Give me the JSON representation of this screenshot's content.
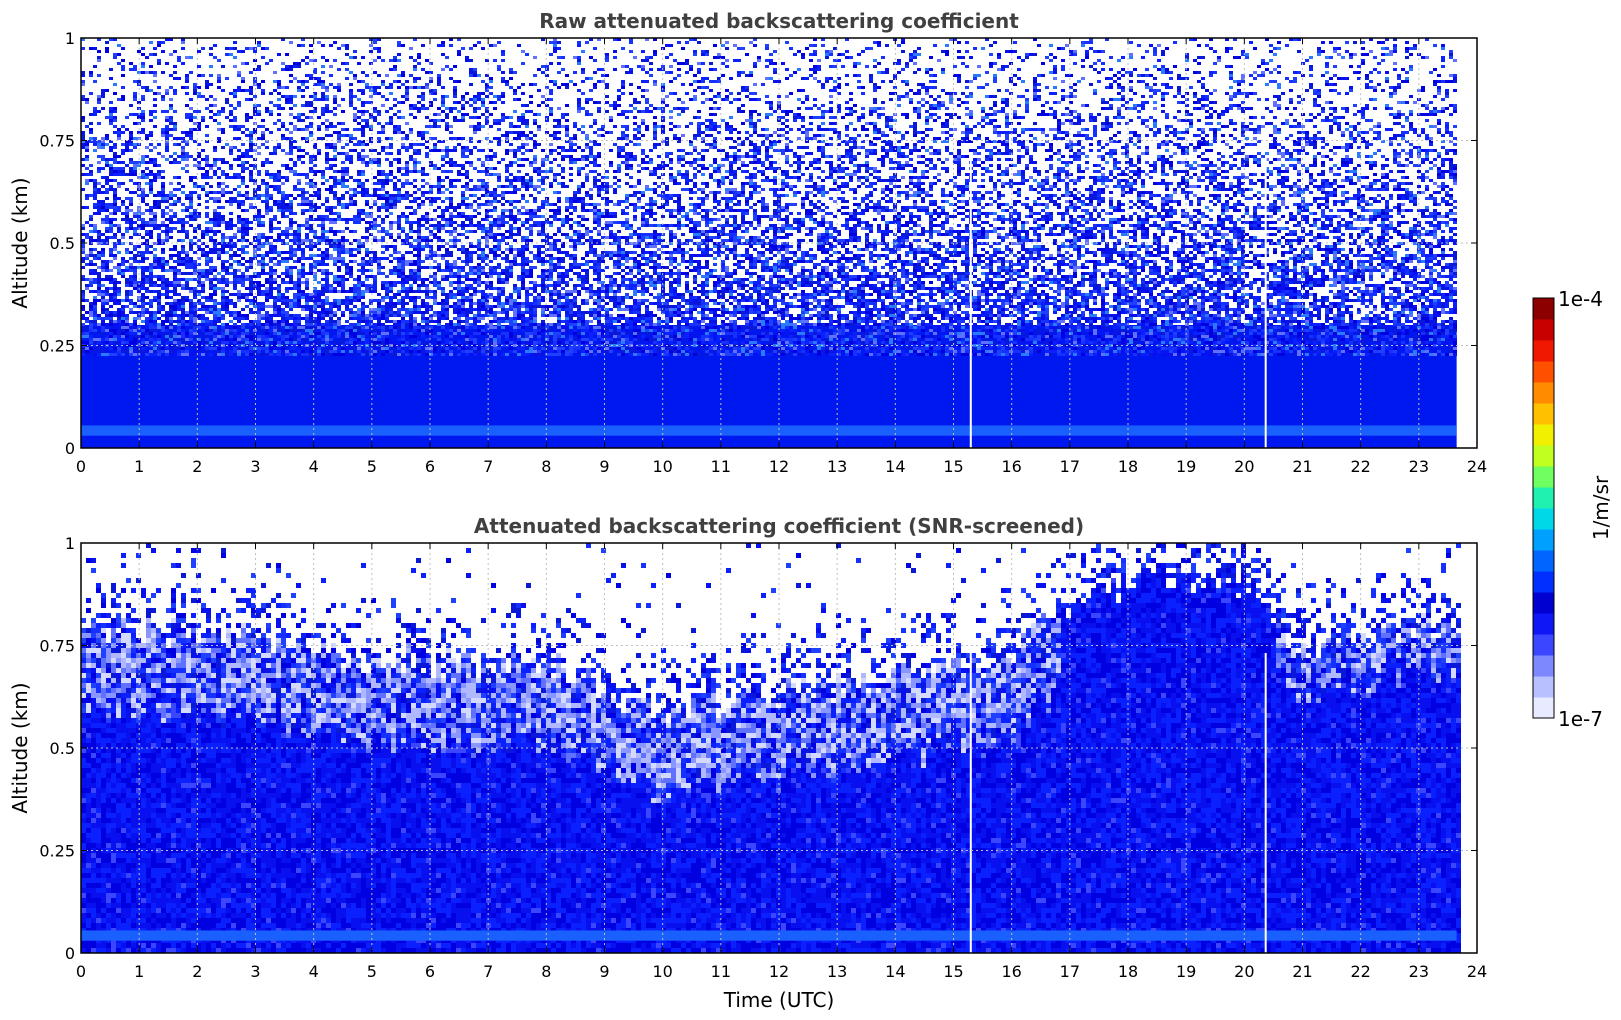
{
  "chart_data": [
    {
      "type": "heatmap",
      "title": "Raw attenuated backscattering coefficient",
      "xlabel": "",
      "ylabel": "Altitude (km)",
      "xlim": [
        0,
        24
      ],
      "ylim": [
        0,
        1
      ],
      "x_ticks": [
        "0",
        "1",
        "2",
        "3",
        "4",
        "5",
        "6",
        "7",
        "8",
        "9",
        "10",
        "11",
        "12",
        "13",
        "14",
        "15",
        "16",
        "17",
        "18",
        "19",
        "20",
        "21",
        "22",
        "23",
        "24"
      ],
      "y_ticks": [
        "0",
        "0.25",
        "0.5",
        "0.75",
        "1"
      ],
      "y_tick_values": [
        0,
        0.25,
        0.5,
        0.75,
        1
      ],
      "grid": true,
      "data_end_time": 23.65,
      "gap_times": [
        15.28,
        20.35
      ],
      "field_description": "Dense blue backscatter below ~0.3 km; sparse noisy speckle (blue/white) increasing with altitude up to 1 km"
    },
    {
      "type": "heatmap",
      "title": "Attenuated backscattering coefficient (SNR-screened)",
      "xlabel": "Time (UTC)",
      "ylabel": "Altitude (km)",
      "xlim": [
        0,
        24
      ],
      "ylim": [
        0,
        1
      ],
      "x_ticks": [
        "0",
        "1",
        "2",
        "3",
        "4",
        "5",
        "6",
        "7",
        "8",
        "9",
        "10",
        "11",
        "12",
        "13",
        "14",
        "15",
        "16",
        "17",
        "18",
        "19",
        "20",
        "21",
        "22",
        "23",
        "24"
      ],
      "y_ticks": [
        "0",
        "0.25",
        "0.5",
        "0.75",
        "1"
      ],
      "y_tick_values": [
        0,
        0.25,
        0.5,
        0.75,
        1
      ],
      "grid": true,
      "data_end_time": 23.65,
      "gap_times": [
        15.28,
        20.35
      ],
      "layer_top_km": [
        [
          0,
          0.78
        ],
        [
          2,
          0.78
        ],
        [
          4,
          0.72
        ],
        [
          6,
          0.7
        ],
        [
          8,
          0.7
        ],
        [
          10,
          0.58
        ],
        [
          12,
          0.62
        ],
        [
          14,
          0.66
        ],
        [
          16,
          0.72
        ],
        [
          17,
          0.85
        ],
        [
          18.5,
          0.92
        ],
        [
          20,
          0.88
        ],
        [
          21,
          0.74
        ],
        [
          23.65,
          0.8
        ]
      ],
      "field_description": "Blue aerosol layer from surface to ~0.6-0.8 km with lighter patches near the top; sparse returns above; deeper layer around 17-20 UTC"
    }
  ],
  "colorbar": {
    "label": "1/m/sr",
    "max_label": "1e-4",
    "min_label": "1e-7",
    "scale": "log",
    "colors": [
      "#e8ebff",
      "#b8c0ff",
      "#7d88ff",
      "#3a46ff",
      "#0f17f5",
      "#0000d0",
      "#0030ff",
      "#0066ff",
      "#00a0ff",
      "#00d8e8",
      "#20f0b0",
      "#70ff60",
      "#c0ff20",
      "#f0f000",
      "#ffc000",
      "#ff8c00",
      "#ff5000",
      "#f01800",
      "#c80000",
      "#8c0000"
    ]
  }
}
